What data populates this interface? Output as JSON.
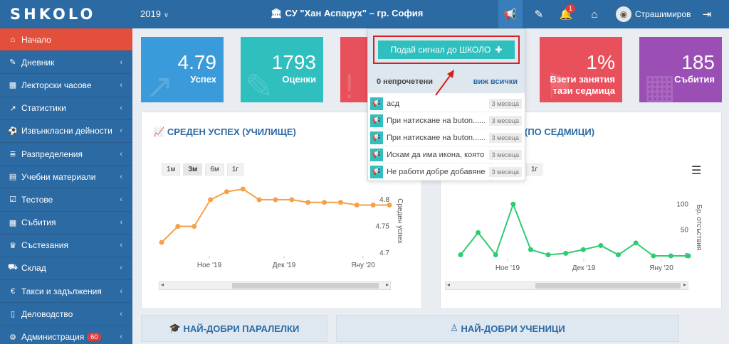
{
  "topbar": {
    "logo": "SHKOLO",
    "year": "2019",
    "school_name": "СУ \"Хан Аспарух\" – гр. София",
    "notification_count": "1",
    "username": "Страшимиров"
  },
  "sidebar": {
    "items": [
      {
        "label": "Начало",
        "icon": "home-icon",
        "glyph": "⌂",
        "active": true
      },
      {
        "label": "Дневник",
        "icon": "edit-icon",
        "glyph": "✎"
      },
      {
        "label": "Лекторски часове",
        "icon": "calendar-icon",
        "glyph": "▦"
      },
      {
        "label": "Статистики",
        "icon": "chart-icon",
        "glyph": "↗"
      },
      {
        "label": "Извънкласни дейности",
        "icon": "ball-icon",
        "glyph": "⚽"
      },
      {
        "label": "Разпределения",
        "icon": "list-icon",
        "glyph": "≣"
      },
      {
        "label": "Учебни материали",
        "icon": "book-icon",
        "glyph": "▤"
      },
      {
        "label": "Тестове",
        "icon": "check-square-icon",
        "glyph": "☑"
      },
      {
        "label": "Събития",
        "icon": "calendar-icon",
        "glyph": "▦"
      },
      {
        "label": "Състезания",
        "icon": "trophy-icon",
        "glyph": "♛"
      },
      {
        "label": "Склад",
        "icon": "cart-icon",
        "glyph": "⛟"
      },
      {
        "label": "Такси и задължения",
        "icon": "euro-icon",
        "glyph": "€"
      },
      {
        "label": "Деловодство",
        "icon": "document-icon",
        "glyph": "▯"
      },
      {
        "label": "Администрация",
        "icon": "cogs-icon",
        "glyph": "⚙",
        "badge": "60"
      }
    ]
  },
  "tiles": [
    {
      "value": "4.79",
      "label": "Успех",
      "color": "#3b9ad9"
    },
    {
      "value": "1793",
      "label": "Оценки",
      "color": "#2fbfbf"
    },
    {
      "value": "",
      "label": "",
      "color": "#e8505b"
    },
    {
      "value": "1%",
      "label": "Взети занятия тази седмица",
      "color": "#e8505b"
    },
    {
      "value": "185",
      "label": "Събития",
      "color": "#9b4fb5"
    }
  ],
  "chart1": {
    "title": "СРЕДЕН УСПЕХ (УЧИЛИЩЕ)",
    "ranges": [
      "1м",
      "3м",
      "6м",
      "1г"
    ],
    "selected_range": "3м",
    "chart_data": {
      "type": "line",
      "ylabel": "Среден успех",
      "y_ticks": [
        "4.8",
        "4.75",
        "4.7"
      ],
      "x_ticks": [
        "Ное '19",
        "Дек '19",
        "Яну '20"
      ],
      "ylim": [
        4.7,
        4.82
      ],
      "values": [
        4.72,
        4.75,
        4.75,
        4.8,
        4.815,
        4.82,
        4.8,
        4.8,
        4.8,
        4.795,
        4.795,
        4.795,
        4.79,
        4.79,
        4.79
      ]
    }
  },
  "chart2": {
    "title": "(ПО СЕДМИЦИ)",
    "ranges": [
      "1г"
    ],
    "chart_data": {
      "type": "line",
      "ylabel": "Бр. отсъствия",
      "y_ticks": [
        "100",
        "50",
        "0"
      ],
      "x_ticks": [
        "Ное '19",
        "Дек '19",
        "Яну '20"
      ],
      "ylim": [
        0,
        110
      ],
      "values": [
        2,
        45,
        2,
        100,
        12,
        2,
        5,
        12,
        20,
        2,
        25,
        0,
        0,
        0
      ]
    }
  },
  "bottom": {
    "best_classes": "НАЙ-ДОБРИ ПАРАЛЕЛКИ",
    "best_students": "НАЙ-ДОБРИ УЧЕНИЦИ"
  },
  "dropdown": {
    "signal_button": "Подай сигнал до ШКОЛО",
    "unread": "0 непрочетени",
    "view_all": "виж всички",
    "items": [
      {
        "text": "асд",
        "time": "3 месеца"
      },
      {
        "text": "При натискане на buton......",
        "time": "3 месеца"
      },
      {
        "text": "При натискане на buton......",
        "time": "3 месеца"
      },
      {
        "text": "Искам да има икона, която...",
        "time": "3 месеца"
      },
      {
        "text": "Не работи добре добавянето...",
        "time": "3 месеца"
      }
    ]
  },
  "colors": {
    "primary": "#2c6aa3",
    "active_menu": "#e2503c",
    "teal": "#2fbfbf",
    "chart1_line": "#f5a14a",
    "chart2_line": "#2ecc71",
    "highlight_red": "#d62020"
  }
}
